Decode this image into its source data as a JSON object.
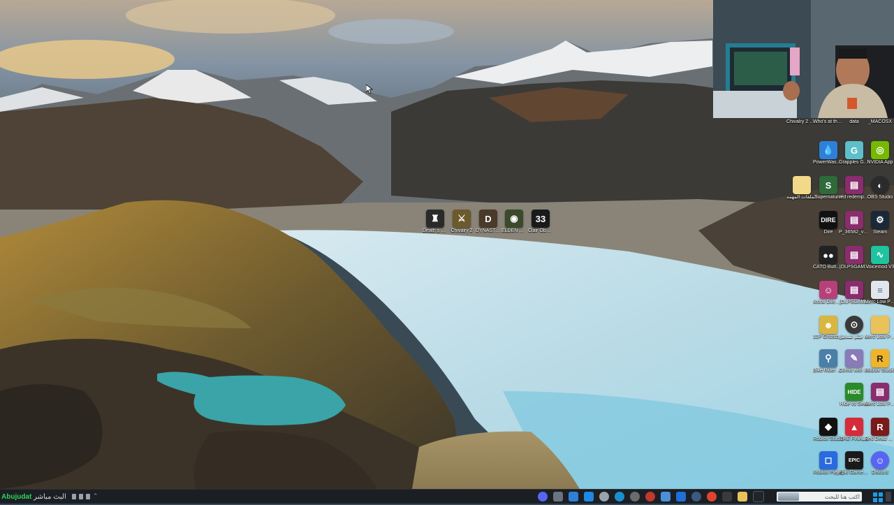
{
  "desktop_icons_center": [
    {
      "label": "Death s Door",
      "icon": "death-door-icon",
      "color": "#2a2a2a"
    },
    {
      "label": "Chivalry 2",
      "icon": "chivalry-icon",
      "color": "#6b5a2c"
    },
    {
      "label": "DYNASTY WARRIO...",
      "icon": "dynasty-warriors-icon",
      "color": "#4a3a2a"
    },
    {
      "label": "ELDEN RING",
      "icon": "elden-ring-icon",
      "color": "#3a4a2a"
    },
    {
      "label": "Clair Obscur Expedition 33",
      "icon": "clair-obscur-icon",
      "color": "#1a1a1a"
    }
  ],
  "desktop_icons_right": [
    {
      "label": "Chivalry 2 Public Te...",
      "icon": "chivalry-test-icon",
      "color": "#4a4a4a"
    },
    {
      "label": "Who's at the door Demo",
      "icon": "whos-at-door-icon",
      "color": "#5a4030"
    },
    {
      "label": "data",
      "icon": "folder-icon",
      "color": "#e9c25a"
    },
    {
      "label": "_MACOSX",
      "icon": "folder-icon",
      "color": "#e9c25a"
    },
    {
      "label": "PowerWash Simulator...",
      "icon": "powerwash-icon",
      "color": "#2f7fd8"
    },
    {
      "label": "Grapples Galore",
      "icon": "grapples-galore-icon",
      "color": "#5dbfc9"
    },
    {
      "label": "NVIDIA App",
      "icon": "nvidia-icon",
      "color": "#76b900"
    },
    {
      "label": "الملفات المهمه",
      "icon": "folder-icon",
      "color": "#f2d98a"
    },
    {
      "label": "Supernatural",
      "icon": "supernatural-icon",
      "color": "#2e6a3a"
    },
    {
      "label": "red redemption 2",
      "icon": "winrar-icon",
      "color": "#8a2c6e"
    },
    {
      "label": "OBS Studio",
      "icon": "obs-icon",
      "color": "#2b2b2b"
    },
    {
      "label": "Dire",
      "icon": "dire-icon",
      "color": "#111111"
    },
    {
      "label": "P_36582_v1...",
      "icon": "winrar-icon",
      "color": "#8a2c6e"
    },
    {
      "label": "Steam",
      "icon": "steam-icon",
      "color": "#1b2838"
    },
    {
      "label": "CATO Buttered C...",
      "icon": "cato-icon",
      "color": "#222222"
    },
    {
      "label": "[DLPSGAM...",
      "icon": "winrar-icon",
      "color": "#8a2c6e"
    },
    {
      "label": "Voicemod V3",
      "icon": "voicemod-icon",
      "color": "#1fc3a0"
    },
    {
      "label": "Moral Dilemma T...",
      "icon": "moral-dilemma-icon",
      "color": "#b8407a"
    },
    {
      "label": "[DLPSGAM...",
      "icon": "winrar-icon",
      "color": "#8a2c6e"
    },
    {
      "label": "Merc Low Ping",
      "icon": "text-file-icon",
      "color": "#dfe6ee"
    },
    {
      "label": "10P Ghostbusters",
      "icon": "ghost-game-icon",
      "color": "#d8b640"
    },
    {
      "label": "خدمة فيلم تسجيل",
      "icon": "cursor-app-icon",
      "color": "#3a3a3a"
    },
    {
      "label": "Merc Low Ping 2024...",
      "icon": "folder-icon",
      "color": "#e9c25a"
    },
    {
      "label": "Bike Rider Simulat...",
      "icon": "bike-icon",
      "color": "#4a7fa8"
    },
    {
      "label": "Comic with Me",
      "icon": "comic-icon",
      "color": "#8a7ab8"
    },
    {
      "label": "Roblox Studio",
      "icon": "roblox-studio-icon",
      "color": "#f0b428"
    },
    {
      "label": "Hide vs Seek",
      "icon": "hide-seek-icon",
      "color": "#2a8a2a"
    },
    {
      "label": "Merc Low Ping 2024...",
      "icon": "winrar-icon",
      "color": "#8a2c6e"
    },
    {
      "label": "Roblox Studio",
      "icon": "roblox-icon",
      "color": "#111111"
    },
    {
      "label": "THE FINALS",
      "icon": "finals-icon",
      "color": "#d62b3a"
    },
    {
      "label": "Red Dead Redemption...",
      "icon": "rdr-icon",
      "color": "#7a1a1a"
    },
    {
      "label": "Roblox Player",
      "icon": "roblox-player-icon",
      "color": "#2a6ae0"
    },
    {
      "label": "Epic Games Launcher",
      "icon": "epic-icon",
      "color": "#1a1a1a"
    },
    {
      "label": "Discord",
      "icon": "discord-icon",
      "color": "#5865f2"
    }
  ],
  "taskbar": {
    "stream_label": "Abujudat",
    "stream_suffix": "البث مباشر",
    "search_placeholder": "اكتب هنا للبحث",
    "apps": [
      {
        "icon": "discord-icon",
        "color": "#5865f2"
      },
      {
        "icon": "file-explorer-icon",
        "color": "#6a7580"
      },
      {
        "icon": "file-icon",
        "color": "#2f7fd8"
      },
      {
        "icon": "pen-icon",
        "color": "#1e88e5"
      },
      {
        "icon": "settings-icon",
        "color": "#9aa3ab"
      },
      {
        "icon": "edge-icon",
        "color": "#1a8fd0"
      },
      {
        "icon": "obs-icon",
        "color": "#6b6b6b"
      },
      {
        "icon": "record-icon",
        "color": "#c0392b"
      },
      {
        "icon": "monitor-icon",
        "color": "#4a90d9"
      },
      {
        "icon": "blue-app-icon",
        "color": "#1e6fd9"
      },
      {
        "icon": "steam-icon",
        "color": "#3b5a80"
      },
      {
        "icon": "chrome-icon",
        "color": "#e0442e"
      },
      {
        "icon": "store-icon",
        "color": "#3a3a3a"
      },
      {
        "icon": "folder-icon",
        "color": "#e9c25a"
      },
      {
        "icon": "terminal-icon",
        "color": "#20252b"
      }
    ]
  }
}
